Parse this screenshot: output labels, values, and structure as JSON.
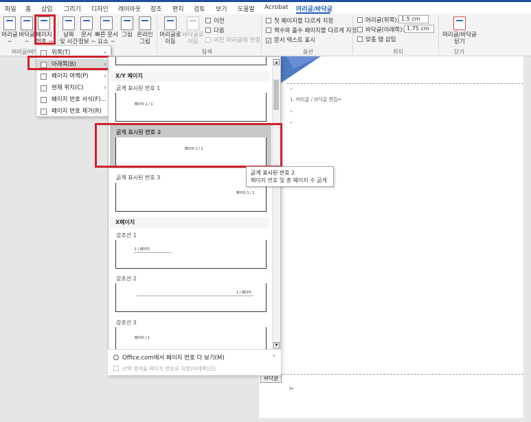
{
  "tabs": [
    "파일",
    "홈",
    "삽입",
    "그리기",
    "디자인",
    "레이아웃",
    "참조",
    "편지",
    "검토",
    "보기",
    "도움말",
    "Acrobat",
    "머리글/바닥글"
  ],
  "active_tab": "머리글/바닥글",
  "ribbon": {
    "header_label": [
      "머리글",
      "~"
    ],
    "footer_label": [
      "바닥글",
      "~"
    ],
    "page_number_label": [
      "페이지",
      "번호 ~"
    ],
    "date_time_label": [
      "날짜",
      "및 시간"
    ],
    "doc_info_label": [
      "문서",
      "정보 ~"
    ],
    "quick_parts_label": [
      "빠른 문서",
      "요소 ~"
    ],
    "picture_label": [
      "그림",
      ""
    ],
    "online_picture_label": [
      "온라인",
      "그림"
    ],
    "goto_header_label": [
      "머리글로",
      "이동"
    ],
    "goto_footer_label": [
      "바닥글로",
      "이동"
    ],
    "previous": "이전",
    "next": "다음",
    "link_prev": "이전 머리글에 연결",
    "diff_first": "첫 페이지를 다르게 지정",
    "diff_odd_even": "짝수와 홀수 페이지를 다르게 지정",
    "show_doc_text": "문서 텍스트 표시",
    "header_top_label": "머리글(위쪽):",
    "header_top_value": "1.5 cm",
    "footer_bottom_label": "바닥글(아래쪽):",
    "footer_bottom_value": "1.75 cm",
    "insert_align_tab": "맞춤 탭 삽입",
    "close_label": [
      "머리글/바닥글",
      "닫기"
    ],
    "group_header_footer": "머리글/바닥",
    "group_navigation": "탐색",
    "group_options": "옵션",
    "group_position": "위치",
    "group_close": "닫기",
    "group_insert_partial": "입"
  },
  "submenu": [
    {
      "label": "위쪽(T)",
      "has_arrow": true
    },
    {
      "label": "아래쪽(B)",
      "has_arrow": true
    },
    {
      "label": "페이지 여백(P)",
      "has_arrow": true
    },
    {
      "label": "현재 위치(C)",
      "has_arrow": true
    },
    {
      "label": "페이지 번호 서식(F)...",
      "has_arrow": false
    },
    {
      "label": "페이지 번호 제거(R)",
      "has_arrow": false
    }
  ],
  "gallery": {
    "section_xy": "X/Y 페이지",
    "item1_label": "굵게 표시된 번호 1",
    "item1_text": "페이지 1 / 1",
    "item2_label": "굵게 표시된 번호 2",
    "item2_text": "페이지 1 / 1",
    "item3_label": "굵게 표시된 번호 3",
    "item3_text": "페이지 1 / 1",
    "section_x": "X페이지",
    "accent1_label": "강조선 1",
    "accent1_text": "1 | 페이지",
    "accent2_label": "강조선 2",
    "accent2_text": "1 | 페이지",
    "accent3_label": "강조선 3",
    "accent3_text": "페이지 | 1",
    "more_office": "Office.com에서 페이지 번호 더 보기(M)",
    "save_selection": "선택 영역을 페이지 번호로 저장(아래쪽)(S)"
  },
  "tooltip": {
    "title": "굵게 표시된 번호 2",
    "description": "페이지 번호 및 총 페이지 수 굵게"
  },
  "document": {
    "body_line": "1. 머리글 / 바닥글 편집↵",
    "footer_tag": "바닥글"
  },
  "colors": {
    "accent": "#1f5cb8",
    "highlight": "#d0202a"
  }
}
